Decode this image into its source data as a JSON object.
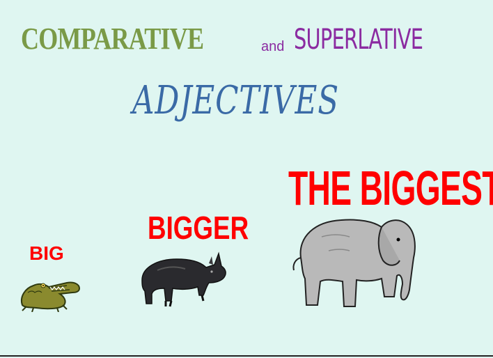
{
  "slide": {
    "title_part1": "COMPARATIVE",
    "title_and": "and",
    "title_part2": "SUPERLATIVE",
    "title_part3": "ADJECTIVES"
  },
  "examples": [
    {
      "label": "BIG",
      "animal_icon": "crocodile-icon"
    },
    {
      "label": "BIGGER",
      "animal_icon": "rhinoceros-icon"
    },
    {
      "label": "THE BIGGEST",
      "animal_icon": "elephant-icon"
    }
  ],
  "colors": {
    "background": "#dff6f1",
    "comparative": "#7a9a47",
    "superlative": "#8b2ba1",
    "adjectives": "#3a6aa6",
    "labels": "#ff0000"
  }
}
